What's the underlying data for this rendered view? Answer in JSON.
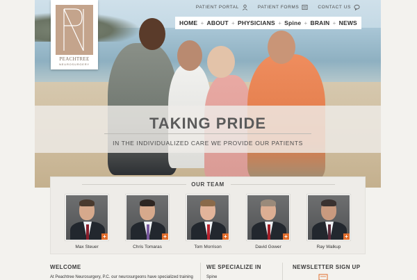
{
  "logo": {
    "name": "PEACHTREE",
    "sub": "NEUROSURGERY"
  },
  "utility_nav": [
    {
      "label": "PATIENT PORTAL",
      "icon": "person-icon"
    },
    {
      "label": "PATIENT FORMS",
      "icon": "document-icon"
    },
    {
      "label": "CONTACT US",
      "icon": "chat-bubble-icon"
    }
  ],
  "main_nav": [
    "HOME",
    "ABOUT",
    "PHYSICIANS",
    "Spine",
    "BRAIN",
    "NEWS"
  ],
  "hero": {
    "title": "TAKING PRIDE",
    "tagline": "IN THE INDIVIDUALIZED CARE WE PROVIDE OUR PATIENTS"
  },
  "team": {
    "heading": "OUR TEAM",
    "members": [
      "Max Steuer",
      "Chris Tomaras",
      "Tom Morrison",
      "David Gower",
      "Ray Walkup"
    ]
  },
  "welcome": {
    "heading": "WELCOME",
    "text": "At Peachtree Neurosurgery, P.C. our neurosurgeons have specialized training"
  },
  "specialize": {
    "heading": "WE SPECIALIZE IN",
    "first_item": "Spine"
  },
  "newsletter": {
    "heading": "NEWSLETTER SIGN UP"
  },
  "colors": {
    "accent": "#e06d2c",
    "logo_tan": "#c4a48c"
  }
}
